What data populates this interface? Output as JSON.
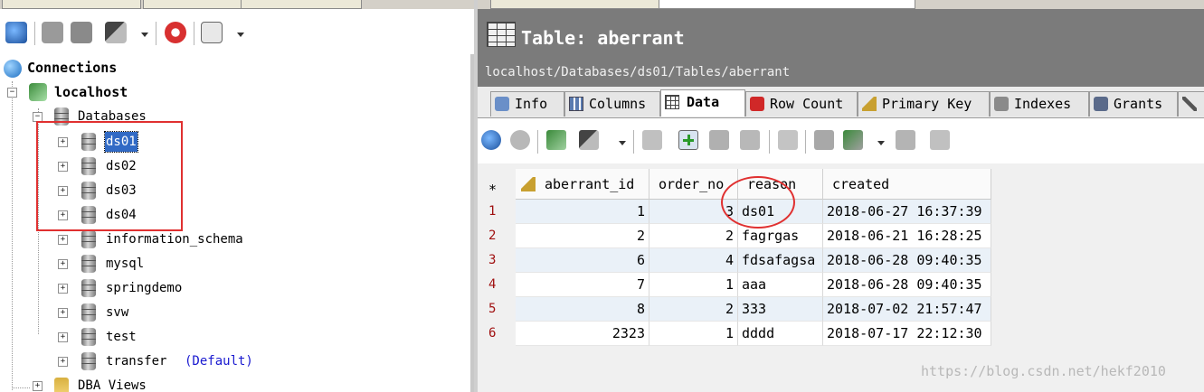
{
  "left": {
    "toolbar_icons": [
      "refresh-icon",
      "schema-icon",
      "sql-icon",
      "connect-icon",
      "stop-icon",
      "filter-icon"
    ],
    "tree": {
      "connections_label": "Connections",
      "server_label": "localhost",
      "databases_label": "Databases",
      "databases": [
        {
          "name": "ds01",
          "selected": true
        },
        {
          "name": "ds02"
        },
        {
          "name": "ds03"
        },
        {
          "name": "ds04"
        },
        {
          "name": "information_schema"
        },
        {
          "name": "mysql"
        },
        {
          "name": "springdemo"
        },
        {
          "name": "svw"
        },
        {
          "name": "test"
        },
        {
          "name": "transfer",
          "suffix": "(Default)"
        }
      ],
      "dba_views_label": "DBA Views"
    }
  },
  "right": {
    "header": {
      "title": "Table: aberrant",
      "path": "localhost/Databases/ds01/Tables/aberrant"
    },
    "subtabs": [
      {
        "label": "Info"
      },
      {
        "label": "Columns"
      },
      {
        "label": "Data",
        "active": true
      },
      {
        "label": "Row Count"
      },
      {
        "label": "Primary Key"
      },
      {
        "label": "Indexes"
      },
      {
        "label": "Grants"
      }
    ],
    "grid": {
      "corner": "*",
      "columns": [
        "aberrant_id",
        "order_no",
        "reason",
        "created"
      ],
      "rows": [
        {
          "n": "1",
          "aberrant_id": "1",
          "order_no": "3",
          "reason": "ds01",
          "created": "2018-06-27 16:37:39"
        },
        {
          "n": "2",
          "aberrant_id": "2",
          "order_no": "2",
          "reason": "fagrgas",
          "created": "2018-06-21 16:28:25"
        },
        {
          "n": "3",
          "aberrant_id": "6",
          "order_no": "4",
          "reason": "fdsafagsa",
          "created": "2018-06-28 09:40:35"
        },
        {
          "n": "4",
          "aberrant_id": "7",
          "order_no": "1",
          "reason": "aaa",
          "created": "2018-06-28 09:40:35"
        },
        {
          "n": "5",
          "aberrant_id": "8",
          "order_no": "2",
          "reason": "333",
          "created": "2018-07-02 21:57:47"
        },
        {
          "n": "6",
          "aberrant_id": "2323",
          "order_no": "1",
          "reason": "dddd",
          "created": "2018-07-17 22:12:30"
        }
      ]
    }
  },
  "watermark": "https://blog.csdn.net/hekf2010",
  "colors": {
    "accent_red": "#e03030",
    "header_gray": "#7b7b7b",
    "selection": "#316ac5"
  }
}
